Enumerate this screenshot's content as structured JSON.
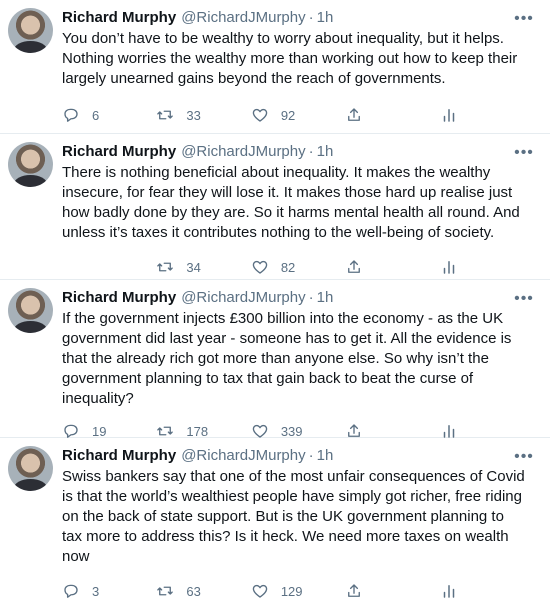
{
  "tweets": [
    {
      "name": "Richard Murphy",
      "handle": "@RichardJMurphy",
      "separator": "·",
      "time": "1h",
      "text": "You don’t have to be wealthy to worry about inequality, but it helps. Nothing worries the wealthy more than working out how to keep their largely unearned gains beyond the reach of governments.",
      "replies": "6",
      "retweets": "33",
      "likes": "92"
    },
    {
      "name": "Richard Murphy",
      "handle": "@RichardJMurphy",
      "separator": "·",
      "time": "1h",
      "text": "There is nothing beneficial about inequality. It makes the wealthy insecure, for fear they will lose it. It makes those hard up realise just how badly done by they are. So it harms mental health all round. And unless it’s taxes it contributes nothing to the well-being of society.",
      "replies": "",
      "retweets": "34",
      "likes": "82"
    },
    {
      "name": "Richard Murphy",
      "handle": "@RichardJMurphy",
      "separator": "·",
      "time": "1h",
      "text": "If the government injects £300 billion into the economy - as the UK government did last year - someone has to get it. All the evidence is that the already rich got more than anyone else. So why isn’t the government planning to tax that gain back to beat the curse of inequality?",
      "replies": "19",
      "retweets": "178",
      "likes": "339"
    },
    {
      "name": "Richard Murphy",
      "handle": "@RichardJMurphy",
      "separator": "·",
      "time": "1h",
      "text": "Swiss bankers say that one of the most unfair consequences of Covid is that the world’s wealthiest people have simply got richer, free riding on the back of state support. But is the UK government planning to tax more to address this? Is it heck. We need more taxes on wealth now",
      "replies": "3",
      "retweets": "63",
      "likes": "129"
    }
  ],
  "colors": {
    "text": "#0f1419",
    "secondary": "#5b7083",
    "divider": "#e6ecf0"
  },
  "icons": [
    "more-icon",
    "reply-icon",
    "retweet-icon",
    "like-icon",
    "share-icon",
    "analytics-icon"
  ]
}
